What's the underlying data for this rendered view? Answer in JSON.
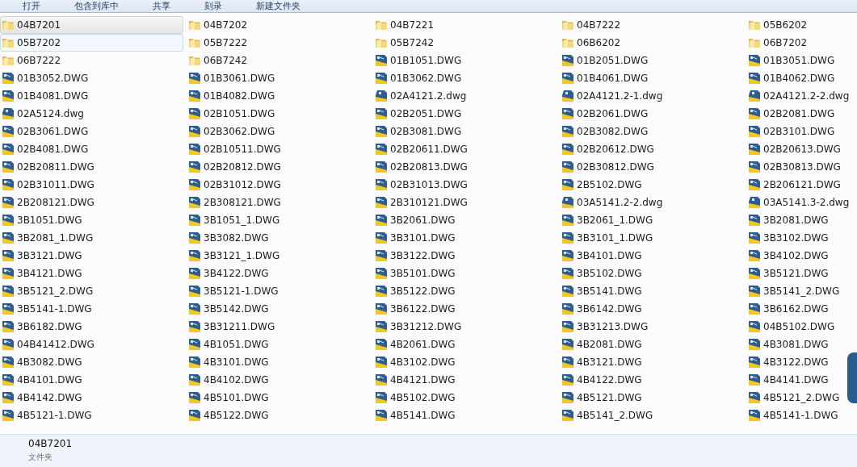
{
  "toolbar": [
    {
      "label": "打开"
    },
    {
      "label": "包含到库中"
    },
    {
      "label": "共享"
    },
    {
      "label": "刻录"
    },
    {
      "label": "新建文件夹"
    }
  ],
  "items": [
    {
      "name": "04B7201",
      "kind": "folder",
      "selected": true,
      "hovered": false
    },
    {
      "name": "04B7202",
      "kind": "folder",
      "selected": false,
      "hovered": false
    },
    {
      "name": "04B7221",
      "kind": "folder",
      "selected": false,
      "hovered": false
    },
    {
      "name": "04B7222",
      "kind": "folder",
      "selected": false,
      "hovered": false
    },
    {
      "name": "05B6202",
      "kind": "folder",
      "selected": false,
      "hovered": false
    },
    {
      "name": "05B7202",
      "kind": "folder",
      "selected": false,
      "hovered": true
    },
    {
      "name": "05B7222",
      "kind": "folder",
      "selected": false,
      "hovered": false
    },
    {
      "name": "05B7242",
      "kind": "folder",
      "selected": false,
      "hovered": false
    },
    {
      "name": "06B6202",
      "kind": "folder",
      "selected": false,
      "hovered": false
    },
    {
      "name": "06B7202",
      "kind": "folder",
      "selected": false,
      "hovered": false
    },
    {
      "name": "06B7222",
      "kind": "folder",
      "selected": false,
      "hovered": false
    },
    {
      "name": "06B7242",
      "kind": "folder",
      "selected": false,
      "hovered": false
    },
    {
      "name": "01B1051.DWG",
      "kind": "dwg",
      "selected": false,
      "hovered": false
    },
    {
      "name": "01B2051.DWG",
      "kind": "dwg",
      "selected": false,
      "hovered": false
    },
    {
      "name": "01B3051.DWG",
      "kind": "dwg",
      "selected": false,
      "hovered": false
    },
    {
      "name": "01B3052.DWG",
      "kind": "dwg",
      "selected": false,
      "hovered": false
    },
    {
      "name": "01B3061.DWG",
      "kind": "dwg",
      "selected": false,
      "hovered": false
    },
    {
      "name": "01B3062.DWG",
      "kind": "dwg",
      "selected": false,
      "hovered": false
    },
    {
      "name": "01B4061.DWG",
      "kind": "dwg",
      "selected": false,
      "hovered": false
    },
    {
      "name": "01B4062.DWG",
      "kind": "dwg",
      "selected": false,
      "hovered": false
    },
    {
      "name": "01B4081.DWG",
      "kind": "dwg",
      "selected": false,
      "hovered": false
    },
    {
      "name": "01B4082.DWG",
      "kind": "dwg",
      "selected": false,
      "hovered": false
    },
    {
      "name": "02A4121.2.dwg",
      "kind": "dwg-alt",
      "selected": false,
      "hovered": false
    },
    {
      "name": "02A4121.2-1.dwg",
      "kind": "dwg-alt",
      "selected": false,
      "hovered": false
    },
    {
      "name": "02A4121.2-2.dwg",
      "kind": "dwg-alt",
      "selected": false,
      "hovered": false
    },
    {
      "name": "02A5124.dwg",
      "kind": "dwg-alt",
      "selected": false,
      "hovered": false
    },
    {
      "name": "02B1051.DWG",
      "kind": "dwg",
      "selected": false,
      "hovered": false
    },
    {
      "name": "02B2051.DWG",
      "kind": "dwg",
      "selected": false,
      "hovered": false
    },
    {
      "name": "02B2061.DWG",
      "kind": "dwg",
      "selected": false,
      "hovered": false
    },
    {
      "name": "02B2081.DWG",
      "kind": "dwg",
      "selected": false,
      "hovered": false
    },
    {
      "name": "02B3061.DWG",
      "kind": "dwg",
      "selected": false,
      "hovered": false
    },
    {
      "name": "02B3062.DWG",
      "kind": "dwg",
      "selected": false,
      "hovered": false
    },
    {
      "name": "02B3081.DWG",
      "kind": "dwg",
      "selected": false,
      "hovered": false
    },
    {
      "name": "02B3082.DWG",
      "kind": "dwg",
      "selected": false,
      "hovered": false
    },
    {
      "name": "02B3101.DWG",
      "kind": "dwg",
      "selected": false,
      "hovered": false
    },
    {
      "name": "02B4081.DWG",
      "kind": "dwg",
      "selected": false,
      "hovered": false
    },
    {
      "name": "02B10511.DWG",
      "kind": "dwg",
      "selected": false,
      "hovered": false
    },
    {
      "name": "02B20611.DWG",
      "kind": "dwg",
      "selected": false,
      "hovered": false
    },
    {
      "name": "02B20612.DWG",
      "kind": "dwg",
      "selected": false,
      "hovered": false
    },
    {
      "name": "02B20613.DWG",
      "kind": "dwg",
      "selected": false,
      "hovered": false
    },
    {
      "name": "02B20811.DWG",
      "kind": "dwg",
      "selected": false,
      "hovered": false
    },
    {
      "name": "02B20812.DWG",
      "kind": "dwg",
      "selected": false,
      "hovered": false
    },
    {
      "name": "02B20813.DWG",
      "kind": "dwg",
      "selected": false,
      "hovered": false
    },
    {
      "name": "02B30812.DWG",
      "kind": "dwg",
      "selected": false,
      "hovered": false
    },
    {
      "name": "02B30813.DWG",
      "kind": "dwg",
      "selected": false,
      "hovered": false
    },
    {
      "name": "02B31011.DWG",
      "kind": "dwg",
      "selected": false,
      "hovered": false
    },
    {
      "name": "02B31012.DWG",
      "kind": "dwg",
      "selected": false,
      "hovered": false
    },
    {
      "name": "02B31013.DWG",
      "kind": "dwg",
      "selected": false,
      "hovered": false
    },
    {
      "name": "2B5102.DWG",
      "kind": "dwg",
      "selected": false,
      "hovered": false
    },
    {
      "name": "2B206121.DWG",
      "kind": "dwg",
      "selected": false,
      "hovered": false
    },
    {
      "name": "2B208121.DWG",
      "kind": "dwg",
      "selected": false,
      "hovered": false
    },
    {
      "name": "2B308121.DWG",
      "kind": "dwg",
      "selected": false,
      "hovered": false
    },
    {
      "name": "2B310121.DWG",
      "kind": "dwg",
      "selected": false,
      "hovered": false
    },
    {
      "name": "03A5141.2-2.dwg",
      "kind": "dwg-alt",
      "selected": false,
      "hovered": false
    },
    {
      "name": "03A5141.3-2.dwg",
      "kind": "dwg-alt",
      "selected": false,
      "hovered": false
    },
    {
      "name": "3B1051.DWG",
      "kind": "dwg",
      "selected": false,
      "hovered": false
    },
    {
      "name": "3B1051_1.DWG",
      "kind": "dwg",
      "selected": false,
      "hovered": false
    },
    {
      "name": "3B2061.DWG",
      "kind": "dwg",
      "selected": false,
      "hovered": false
    },
    {
      "name": "3B2061_1.DWG",
      "kind": "dwg",
      "selected": false,
      "hovered": false
    },
    {
      "name": "3B2081.DWG",
      "kind": "dwg",
      "selected": false,
      "hovered": false
    },
    {
      "name": "3B2081_1.DWG",
      "kind": "dwg",
      "selected": false,
      "hovered": false
    },
    {
      "name": "3B3082.DWG",
      "kind": "dwg",
      "selected": false,
      "hovered": false
    },
    {
      "name": "3B3101.DWG",
      "kind": "dwg",
      "selected": false,
      "hovered": false
    },
    {
      "name": "3B3101_1.DWG",
      "kind": "dwg",
      "selected": false,
      "hovered": false
    },
    {
      "name": "3B3102.DWG",
      "kind": "dwg",
      "selected": false,
      "hovered": false
    },
    {
      "name": "3B3121.DWG",
      "kind": "dwg",
      "selected": false,
      "hovered": false
    },
    {
      "name": "3B3121_1.DWG",
      "kind": "dwg",
      "selected": false,
      "hovered": false
    },
    {
      "name": "3B3122.DWG",
      "kind": "dwg",
      "selected": false,
      "hovered": false
    },
    {
      "name": "3B4101.DWG",
      "kind": "dwg",
      "selected": false,
      "hovered": false
    },
    {
      "name": "3B4102.DWG",
      "kind": "dwg",
      "selected": false,
      "hovered": false
    },
    {
      "name": "3B4121.DWG",
      "kind": "dwg",
      "selected": false,
      "hovered": false
    },
    {
      "name": "3B4122.DWG",
      "kind": "dwg",
      "selected": false,
      "hovered": false
    },
    {
      "name": "3B5101.DWG",
      "kind": "dwg",
      "selected": false,
      "hovered": false
    },
    {
      "name": "3B5102.DWG",
      "kind": "dwg",
      "selected": false,
      "hovered": false
    },
    {
      "name": "3B5121.DWG",
      "kind": "dwg",
      "selected": false,
      "hovered": false
    },
    {
      "name": "3B5121_2.DWG",
      "kind": "dwg",
      "selected": false,
      "hovered": false
    },
    {
      "name": "3B5121-1.DWG",
      "kind": "dwg",
      "selected": false,
      "hovered": false
    },
    {
      "name": "3B5122.DWG",
      "kind": "dwg",
      "selected": false,
      "hovered": false
    },
    {
      "name": "3B5141.DWG",
      "kind": "dwg",
      "selected": false,
      "hovered": false
    },
    {
      "name": "3B5141_2.DWG",
      "kind": "dwg",
      "selected": false,
      "hovered": false
    },
    {
      "name": "3B5141-1.DWG",
      "kind": "dwg",
      "selected": false,
      "hovered": false
    },
    {
      "name": "3B5142.DWG",
      "kind": "dwg",
      "selected": false,
      "hovered": false
    },
    {
      "name": "3B6122.DWG",
      "kind": "dwg",
      "selected": false,
      "hovered": false
    },
    {
      "name": "3B6142.DWG",
      "kind": "dwg",
      "selected": false,
      "hovered": false
    },
    {
      "name": "3B6162.DWG",
      "kind": "dwg",
      "selected": false,
      "hovered": false
    },
    {
      "name": "3B6182.DWG",
      "kind": "dwg",
      "selected": false,
      "hovered": false
    },
    {
      "name": "3B31211.DWG",
      "kind": "dwg",
      "selected": false,
      "hovered": false
    },
    {
      "name": "3B31212.DWG",
      "kind": "dwg",
      "selected": false,
      "hovered": false
    },
    {
      "name": "3B31213.DWG",
      "kind": "dwg",
      "selected": false,
      "hovered": false
    },
    {
      "name": "04B5102.DWG",
      "kind": "dwg",
      "selected": false,
      "hovered": false
    },
    {
      "name": "04B41412.DWG",
      "kind": "dwg",
      "selected": false,
      "hovered": false
    },
    {
      "name": "4B1051.DWG",
      "kind": "dwg",
      "selected": false,
      "hovered": false
    },
    {
      "name": "4B2061.DWG",
      "kind": "dwg",
      "selected": false,
      "hovered": false
    },
    {
      "name": "4B2081.DWG",
      "kind": "dwg",
      "selected": false,
      "hovered": false
    },
    {
      "name": "4B3081.DWG",
      "kind": "dwg",
      "selected": false,
      "hovered": false
    },
    {
      "name": "4B3082.DWG",
      "kind": "dwg",
      "selected": false,
      "hovered": false
    },
    {
      "name": "4B3101.DWG",
      "kind": "dwg",
      "selected": false,
      "hovered": false
    },
    {
      "name": "4B3102.DWG",
      "kind": "dwg",
      "selected": false,
      "hovered": false
    },
    {
      "name": "4B3121.DWG",
      "kind": "dwg",
      "selected": false,
      "hovered": false
    },
    {
      "name": "4B3122.DWG",
      "kind": "dwg",
      "selected": false,
      "hovered": false
    },
    {
      "name": "4B4101.DWG",
      "kind": "dwg",
      "selected": false,
      "hovered": false
    },
    {
      "name": "4B4102.DWG",
      "kind": "dwg",
      "selected": false,
      "hovered": false
    },
    {
      "name": "4B4121.DWG",
      "kind": "dwg",
      "selected": false,
      "hovered": false
    },
    {
      "name": "4B4122.DWG",
      "kind": "dwg",
      "selected": false,
      "hovered": false
    },
    {
      "name": "4B4141.DWG",
      "kind": "dwg",
      "selected": false,
      "hovered": false
    },
    {
      "name": "4B4142.DWG",
      "kind": "dwg",
      "selected": false,
      "hovered": false
    },
    {
      "name": "4B5101.DWG",
      "kind": "dwg",
      "selected": false,
      "hovered": false
    },
    {
      "name": "4B5102.DWG",
      "kind": "dwg",
      "selected": false,
      "hovered": false
    },
    {
      "name": "4B5121.DWG",
      "kind": "dwg",
      "selected": false,
      "hovered": false
    },
    {
      "name": "4B5121_2.DWG",
      "kind": "dwg",
      "selected": false,
      "hovered": false
    },
    {
      "name": "4B5121-1.DWG",
      "kind": "dwg",
      "selected": false,
      "hovered": false
    },
    {
      "name": "4B5122.DWG",
      "kind": "dwg",
      "selected": false,
      "hovered": false
    },
    {
      "name": "4B5141.DWG",
      "kind": "dwg",
      "selected": false,
      "hovered": false
    },
    {
      "name": "4B5141_2.DWG",
      "kind": "dwg",
      "selected": false,
      "hovered": false
    },
    {
      "name": "4B5141-1.DWG",
      "kind": "dwg",
      "selected": false,
      "hovered": false
    }
  ],
  "details": {
    "name": "04B7201",
    "type": "文件夹"
  }
}
